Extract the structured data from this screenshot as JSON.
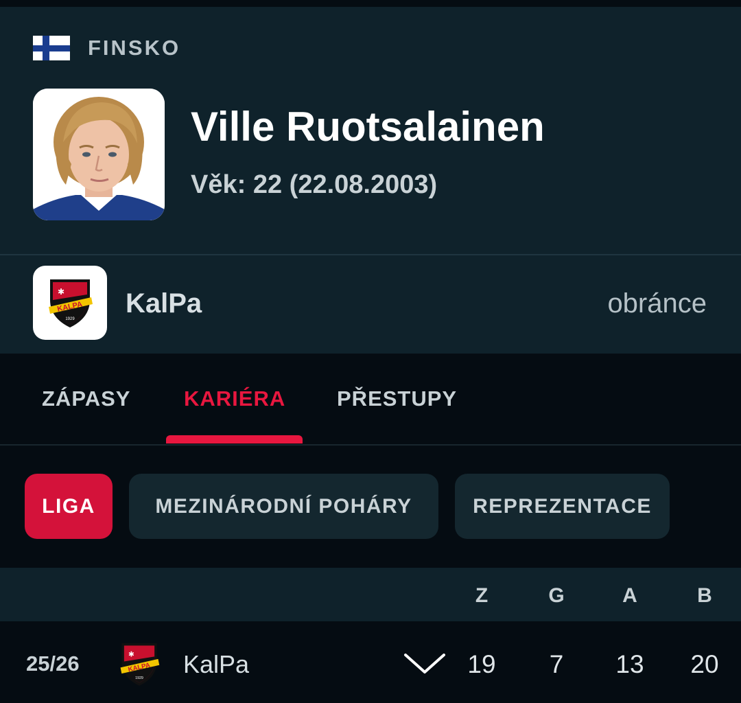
{
  "header": {
    "country": "FINSKO",
    "player_name": "Ville Ruotsalainen",
    "age_label": "Věk:",
    "age_value": "22 (22.08.2003)"
  },
  "team": {
    "name": "KalPa",
    "position": "obránce",
    "logo_text": "KALPA",
    "logo_year": "1929"
  },
  "tabs": [
    {
      "label": "ZÁPASY",
      "active": false
    },
    {
      "label": "KARIÉRA",
      "active": true
    },
    {
      "label": "PŘESTUPY",
      "active": false
    }
  ],
  "filters": [
    {
      "label": "LIGA",
      "active": true
    },
    {
      "label": "MEZINÁRODNÍ POHÁRY",
      "active": false
    },
    {
      "label": "REPREZENTACE",
      "active": false
    }
  ],
  "table": {
    "columns": [
      "Z",
      "G",
      "A",
      "B"
    ],
    "rows": [
      {
        "season": "25/26",
        "team": "KalPa",
        "values": [
          "19",
          "7",
          "13",
          "20"
        ]
      }
    ]
  },
  "colors": {
    "accent": "#e8173f",
    "panel": "#0f222b",
    "background": "#050c12"
  },
  "icons": {
    "country_flag": "finland-flag-icon",
    "expand": "chevron-down-icon"
  }
}
